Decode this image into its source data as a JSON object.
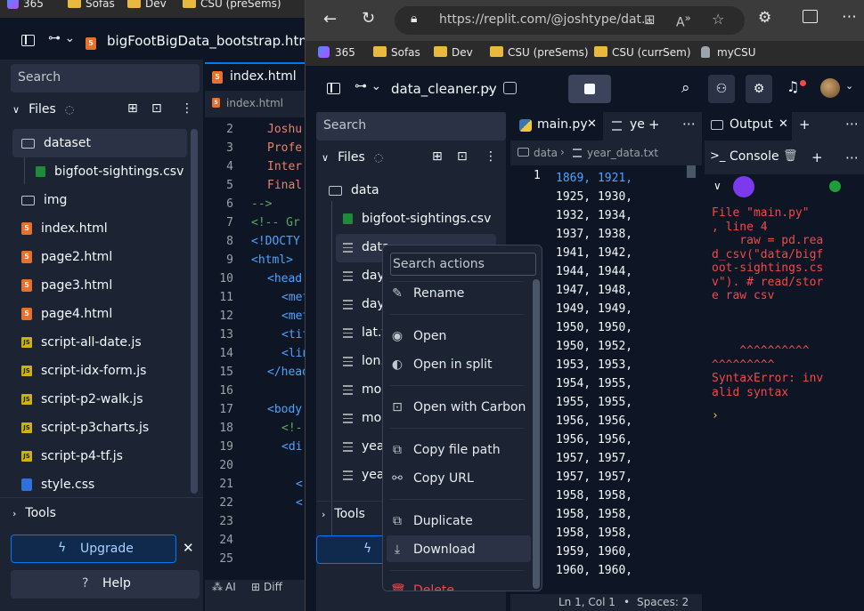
{
  "left_window": {
    "bookmarks": [
      "365",
      "Sofas",
      "Dev",
      "CSU (preSems)"
    ],
    "file_title": "bigFootBigData_bootstrap.html",
    "search_placeholder": "Search",
    "files_label": "Files",
    "tree": [
      {
        "name": "dataset",
        "type": "folder"
      },
      {
        "name": "bigfoot-sightings.csv",
        "type": "csv"
      },
      {
        "name": "img",
        "type": "folder"
      },
      {
        "name": "index.html",
        "type": "html"
      },
      {
        "name": "page2.html",
        "type": "html"
      },
      {
        "name": "page3.html",
        "type": "html"
      },
      {
        "name": "page4.html",
        "type": "html"
      },
      {
        "name": "script-all-date.js",
        "type": "js"
      },
      {
        "name": "script-idx-form.js",
        "type": "js"
      },
      {
        "name": "script-p2-walk.js",
        "type": "js"
      },
      {
        "name": "script-p3charts.js",
        "type": "js"
      },
      {
        "name": "script-p4-tf.js",
        "type": "js"
      },
      {
        "name": "style.css",
        "type": "css"
      }
    ],
    "tools_label": "Tools",
    "upgrade_label": "Upgrade",
    "help_label": "Help",
    "editor_tab": "index.html",
    "editor_breadcrumb": "index.html",
    "line_numbers": [
      "2",
      "3",
      "4",
      "5",
      "6",
      "7",
      "8",
      "9",
      "10",
      "11",
      "12",
      "13",
      "14",
      "15",
      "16",
      "17",
      "18",
      "19",
      "20",
      "21",
      "22",
      "23",
      "24",
      "25"
    ],
    "code_lines": [
      "Joshu",
      "Profe",
      "Inter",
      "Final",
      "-->",
      "<!-- Gr",
      "<!DOCTY",
      "<html>",
      "<head",
      "<met",
      "<met",
      "<tit",
      "<lin",
      "</head",
      "",
      "<body",
      "<!-",
      "<di",
      "",
      "<",
      "<",
      "",
      "",
      ""
    ],
    "status_ai": "AI",
    "status_diff": "Diff"
  },
  "browser": {
    "url": "https://replit.com/@joshtype/dat...",
    "url_host": "replit.com",
    "bookmarks": [
      "365",
      "Sofas",
      "Dev",
      "CSU (preSems)",
      "CSU (currSem)",
      "myCSU"
    ]
  },
  "repl": {
    "title": "data_cleaner.py",
    "search_placeholder": "Search",
    "files_label": "Files",
    "tree": [
      {
        "name": "data",
        "type": "folder"
      },
      {
        "name": "bigfoot-sightings.csv",
        "type": "csv"
      },
      {
        "name": "data_",
        "type": "txt"
      },
      {
        "name": "day_",
        "type": "txt"
      },
      {
        "name": "day_",
        "type": "txt"
      },
      {
        "name": "lat.tx",
        "type": "txt"
      },
      {
        "name": "lon.t",
        "type": "txt"
      },
      {
        "name": "mon",
        "type": "txt"
      },
      {
        "name": "mon",
        "type": "txt"
      },
      {
        "name": "year",
        "type": "txt"
      },
      {
        "name": "year",
        "type": "txt"
      }
    ],
    "tools_label": "Tools",
    "tabs": [
      "main.py",
      "ye"
    ],
    "breadcrumb": [
      "data",
      "year_data.txt"
    ],
    "line_number": "1",
    "data_lines": [
      "1869, 1921,",
      "1925, 1930,",
      "1932, 1934,",
      "1937, 1938,",
      "1941, 1942,",
      "1944, 1944,",
      "1947, 1948,",
      "1949, 1949,",
      "1950, 1950,",
      "1950, 1952,",
      "1953, 1953,",
      "1954, 1955,",
      "1955, 1955,",
      "1956, 1956,",
      "1956, 1956,",
      "1957, 1957,",
      "1957, 1957,",
      "1958, 1958,",
      "1958, 1958,",
      "1958, 1958,",
      "1959, 1960,",
      "1960, 1960,"
    ],
    "status_position": "Ln 1, Col 1",
    "status_spaces": "Spaces: 2",
    "output_tab": "Output",
    "console_tab": "Console",
    "console_lines": [
      "File \"main.py\"",
      ", line 4",
      "    raw = pd.rea",
      "d_csv(\"data/bigf",
      "oot-sightings.cs",
      "v\"). # read/stor",
      "e raw csv",
      "",
      "",
      "",
      "    ^^^^^^^^^^",
      "^^^^^^^^^",
      "SyntaxError: inv",
      "alid syntax"
    ],
    "prompt_char": "›"
  },
  "context_menu": {
    "search_placeholder": "Search actions",
    "items": [
      "Rename",
      "Open",
      "Open in split",
      "Open with Carbon",
      "Copy file path",
      "Copy URL",
      "Duplicate",
      "Download",
      "Delete"
    ]
  },
  "colors": {
    "bg": "#0e1525",
    "panel": "#1c2333",
    "accent": "#0079f2",
    "error": "#f44747",
    "csv_green": "#1f8a3a"
  }
}
